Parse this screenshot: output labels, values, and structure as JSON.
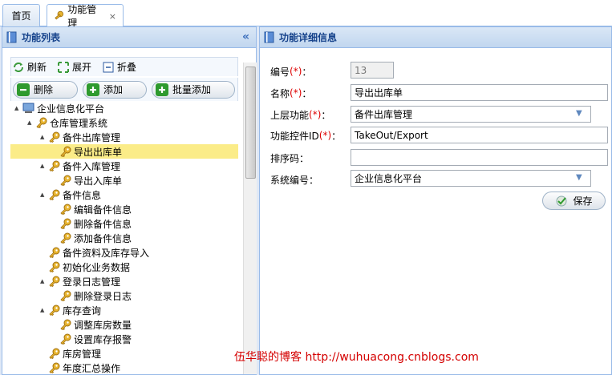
{
  "tabs": [
    {
      "label": "首页"
    },
    {
      "label": "功能管理",
      "close": "×"
    }
  ],
  "left_panel": {
    "title": "功能列表",
    "collapse_icon": "«"
  },
  "toolbar": {
    "refresh": "刷新",
    "expand": "展开",
    "collapse": "折叠"
  },
  "buttons": {
    "delete": "删除",
    "add": "添加",
    "batch_add": "批量添加"
  },
  "tree": [
    {
      "label": "企业信息化平台",
      "level": 0,
      "toggle": "▲",
      "icon": "computer-icon"
    },
    {
      "label": "仓库管理系统",
      "level": 1,
      "toggle": "▲",
      "icon": "key-icon"
    },
    {
      "label": "备件出库管理",
      "level": 2,
      "toggle": "▲",
      "icon": "key-icon"
    },
    {
      "label": "导出出库单",
      "level": 3,
      "toggle": "",
      "icon": "key-icon",
      "selected": true
    },
    {
      "label": "备件入库管理",
      "level": 2,
      "toggle": "▲",
      "icon": "key-icon"
    },
    {
      "label": "导出入库单",
      "level": 3,
      "toggle": "",
      "icon": "key-icon"
    },
    {
      "label": "备件信息",
      "level": 2,
      "toggle": "▲",
      "icon": "key-icon"
    },
    {
      "label": "编辑备件信息",
      "level": 3,
      "toggle": "",
      "icon": "key-icon"
    },
    {
      "label": "删除备件信息",
      "level": 3,
      "toggle": "",
      "icon": "key-icon"
    },
    {
      "label": "添加备件信息",
      "level": 3,
      "toggle": "",
      "icon": "key-icon"
    },
    {
      "label": "备件资料及库存导入",
      "level": 2,
      "toggle": "",
      "icon": "key-icon"
    },
    {
      "label": "初始化业务数据",
      "level": 2,
      "toggle": "",
      "icon": "key-icon"
    },
    {
      "label": "登录日志管理",
      "level": 2,
      "toggle": "▲",
      "icon": "key-icon"
    },
    {
      "label": "删除登录日志",
      "level": 3,
      "toggle": "",
      "icon": "key-icon"
    },
    {
      "label": "库存查询",
      "level": 2,
      "toggle": "▲",
      "icon": "key-icon"
    },
    {
      "label": "调整库房数量",
      "level": 3,
      "toggle": "",
      "icon": "key-icon"
    },
    {
      "label": "设置库存报警",
      "level": 3,
      "toggle": "",
      "icon": "key-icon"
    },
    {
      "label": "库房管理",
      "level": 2,
      "toggle": "",
      "icon": "key-icon"
    },
    {
      "label": "年度汇总操作",
      "level": 2,
      "toggle": "",
      "icon": "key-icon"
    }
  ],
  "right_panel": {
    "title": "功能详细信息"
  },
  "form": {
    "id": {
      "label": "编号",
      "req": "(*)",
      "suffix": "：",
      "value": "13"
    },
    "name": {
      "label": "名称",
      "req": "(*)",
      "suffix": "：",
      "value": "导出出库单"
    },
    "parent": {
      "label": "上层功能",
      "req": "(*)",
      "suffix": "：",
      "value": "备件出库管理"
    },
    "control": {
      "label": "功能控件ID",
      "req": "(*)",
      "suffix": "：",
      "value": "TakeOut/Export"
    },
    "sort": {
      "label": "排序码",
      "suffix": "：",
      "value": ""
    },
    "system": {
      "label": "系统编号",
      "suffix": "：",
      "value": "企业信息化平台"
    },
    "save": "保存"
  },
  "watermark": {
    "text": "伍华聪的博客 http://wuhuacong.cnblogs.com"
  },
  "colors": {
    "accent": "#15428b",
    "border": "#99bbe8",
    "selection": "#fbec88",
    "required": "#dd0000"
  }
}
